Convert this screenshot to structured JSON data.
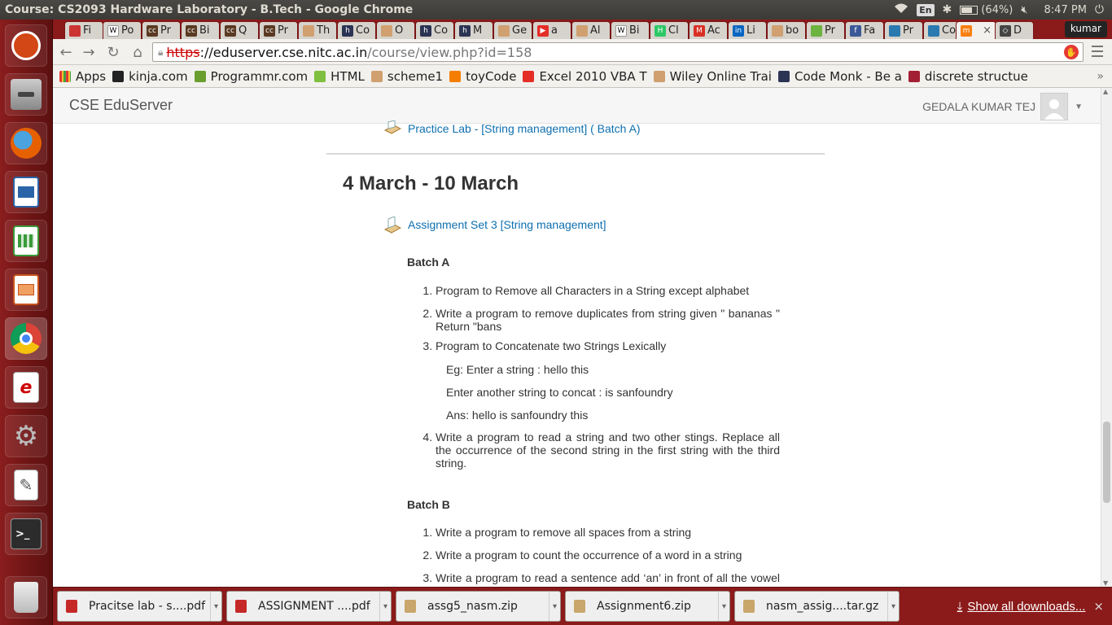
{
  "os": {
    "window_title": "Course: CS2093 Hardware Laboratory - B.Tech - Google Chrome",
    "keyboard_layout": "En",
    "battery": "(64%)",
    "clock": "8:47 PM"
  },
  "launcher": {
    "items": [
      "ubuntu-dash",
      "files",
      "firefox",
      "writer",
      "calc",
      "impress",
      "chrome",
      "document-viewer",
      "system-settings",
      "text-editor",
      "terminal",
      "trash"
    ]
  },
  "browser": {
    "tabs": [
      {
        "label": "Fi",
        "icon": "pdf"
      },
      {
        "label": "Po",
        "icon": "wikipedia"
      },
      {
        "label": "Pr",
        "icon": "cc"
      },
      {
        "label": "Bi",
        "icon": "cc"
      },
      {
        "label": "Q",
        "icon": "cc"
      },
      {
        "label": "Pr",
        "icon": "cc"
      },
      {
        "label": "Th",
        "icon": "doc"
      },
      {
        "label": "Co",
        "icon": "hackerearth"
      },
      {
        "label": "O",
        "icon": "doc"
      },
      {
        "label": "Co",
        "icon": "hackerearth"
      },
      {
        "label": "M",
        "icon": "hackerearth"
      },
      {
        "label": "Ge",
        "icon": "doc"
      },
      {
        "label": "a",
        "icon": "youtube"
      },
      {
        "label": "Al",
        "icon": "doc"
      },
      {
        "label": "Bi",
        "icon": "wikipedia"
      },
      {
        "label": "Cl",
        "icon": "hackerrank"
      },
      {
        "label": "Ac",
        "icon": "gmail"
      },
      {
        "label": "Li",
        "icon": "linkedin"
      },
      {
        "label": "bo",
        "icon": "doc"
      },
      {
        "label": "Pr",
        "icon": "green"
      },
      {
        "label": "Fa",
        "icon": "facebook"
      },
      {
        "label": "Pr",
        "icon": "chart"
      },
      {
        "label": "Co",
        "icon": "chart"
      },
      {
        "label": "",
        "icon": "moodle",
        "active": true,
        "close": "×"
      },
      {
        "label": "D",
        "icon": "diamond"
      }
    ],
    "profile": "kumar",
    "address": {
      "scheme": "https",
      "host": "://eduserver.cse.nitc.ac.in",
      "path": "/course/view.php?id=158"
    },
    "bookmarks": [
      {
        "label": "Apps",
        "icon": "apps"
      },
      {
        "label": "kinja.com",
        "icon": "kinja"
      },
      {
        "label": "Programmr.com",
        "icon": "programmr"
      },
      {
        "label": "HTML",
        "icon": "html"
      },
      {
        "label": "scheme1",
        "icon": "doc"
      },
      {
        "label": "toyCode",
        "icon": "blogger"
      },
      {
        "label": "Excel 2010 VBA T",
        "icon": "youtube"
      },
      {
        "label": "Wiley Online Trai",
        "icon": "doc"
      },
      {
        "label": "Code Monk - Be a",
        "icon": "hackerearth"
      },
      {
        "label": "discrete structue",
        "icon": "mit"
      }
    ]
  },
  "site": {
    "brand": "CSE EduServer",
    "user_name": "GEDALA KUMAR TEJ",
    "prev_activity": "Practice Lab - [String management] ( Batch A)",
    "week_title": "4 March - 10 March",
    "activity": "Assignment Set 3 [String management]",
    "batch_a": {
      "title": "Batch A",
      "items": [
        "Program to Remove all Characters in a String except alphabet",
        "Write a program to remove duplicates from string given \" bananas \" Return \"bans",
        "Program to Concatenate two Strings Lexically",
        "Write a program to read a string and two other stings. Replace all the occurrence of the second string in the first string with the third string."
      ],
      "example": [
        "Eg: Enter a string : hello this",
        "Enter another string to concat : is sanfoundry",
        "Ans: hello is sanfoundry this"
      ]
    },
    "batch_b": {
      "title": "Batch B",
      "items": [
        "Write a program to remove all spaces from a string",
        "Write a program to count the occurrence of a word in a string",
        "Write a program to read a sentence add ‘an’ in front of all the vowel words"
      ]
    }
  },
  "downloads": {
    "items": [
      {
        "name": "Pracitse lab - s....pdf",
        "type": "pdf"
      },
      {
        "name": "ASSIGNMENT ....pdf",
        "type": "pdf"
      },
      {
        "name": "assg5_nasm.zip",
        "type": "zip"
      },
      {
        "name": "Assignment6.zip",
        "type": "zip"
      },
      {
        "name": "nasm_assig....tar.gz",
        "type": "zip"
      }
    ],
    "show_all": "Show all downloads...",
    "close": "×"
  }
}
